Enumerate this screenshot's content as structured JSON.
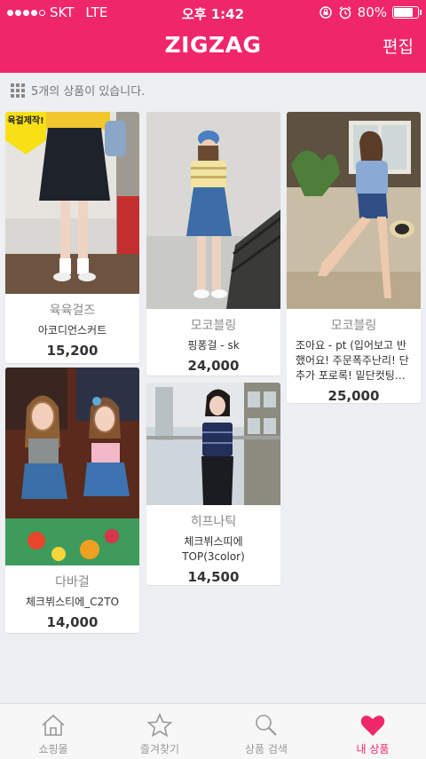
{
  "status_bar": {
    "carrier": "SKT",
    "network": "LTE",
    "time": "오후 1:42",
    "battery_percent_text": "80%",
    "battery_level": 0.8
  },
  "header": {
    "logo": "ZIGZAG",
    "edit_label": "편집",
    "background_color": "#f0266b"
  },
  "list": {
    "count_text": "5개의 상품이 있습니다."
  },
  "products": [
    {
      "shop": "육육걸즈",
      "name": "아코디언스커트",
      "price": "15,200",
      "badge": "육걸제작!"
    },
    {
      "shop": "모코블링",
      "name": "핑퐁걸 - sk",
      "price": "24,000"
    },
    {
      "shop": "모코블링",
      "name": "조아요 - pt (입어보고 반했어요! 주문폭주난리! 단추가 포로록! 밑단컷팅…",
      "price": "25,000"
    },
    {
      "shop": "다바걸",
      "name": "체크뷔스티에_C2TO",
      "price": "14,000"
    },
    {
      "shop": "히프나틱",
      "name": "체크뷔스띠에 TOP(3color)",
      "price": "14,500"
    }
  ],
  "tabbar": {
    "items": [
      {
        "label": "쇼핑몰",
        "icon": "house-icon"
      },
      {
        "label": "즐겨찾기",
        "icon": "star-icon"
      },
      {
        "label": "상품 검색",
        "icon": "search-icon"
      },
      {
        "label": "내 상품",
        "icon": "heart-icon",
        "active": true
      }
    ]
  }
}
